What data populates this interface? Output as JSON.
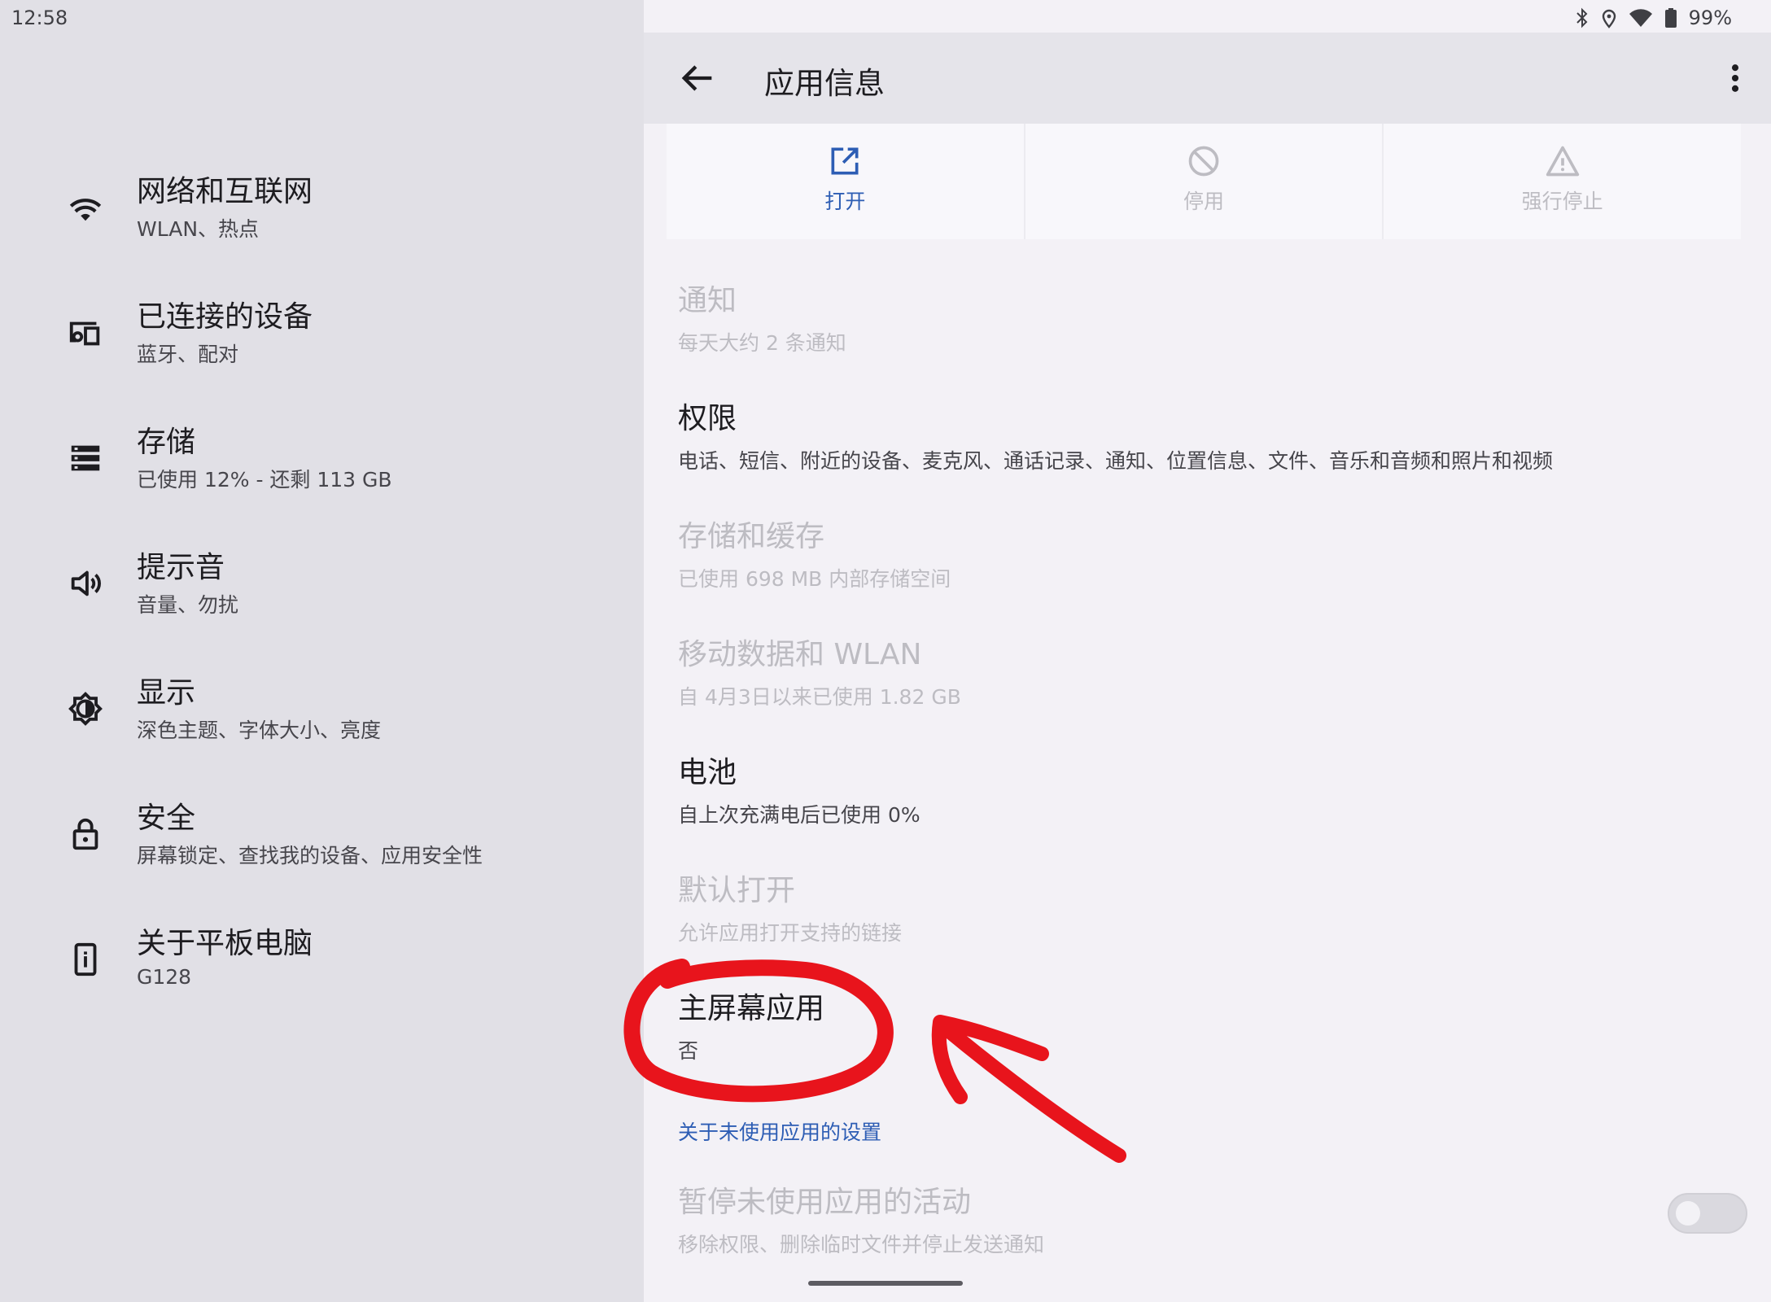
{
  "status_bar": {
    "time": "12:58",
    "battery": "99%",
    "icons": [
      "bluetooth-icon",
      "location-icon",
      "wifi-icon",
      "battery-icon"
    ]
  },
  "sidebar": {
    "items": [
      {
        "title": "网络和互联网",
        "subtitle": "WLAN、热点",
        "icon": "wifi-icon"
      },
      {
        "title": "已连接的设备",
        "subtitle": "蓝牙、配对",
        "icon": "devices-icon"
      },
      {
        "title": "存储",
        "subtitle": "已使用 12% - 还剩 113 GB",
        "icon": "storage-icon"
      },
      {
        "title": "提示音",
        "subtitle": "音量、勿扰",
        "icon": "volume-icon"
      },
      {
        "title": "显示",
        "subtitle": "深色主题、字体大小、亮度",
        "icon": "brightness-icon"
      },
      {
        "title": "安全",
        "subtitle": "屏幕锁定、查找我的设备、应用安全性",
        "icon": "lock-icon"
      },
      {
        "title": "关于平板电脑",
        "subtitle": "G128",
        "icon": "tablet-info-icon"
      }
    ]
  },
  "app_bar": {
    "title": "应用信息"
  },
  "actions": [
    {
      "label": "打开",
      "icon": "open-external-icon",
      "enabled": true
    },
    {
      "label": "停用",
      "icon": "disable-icon",
      "enabled": false
    },
    {
      "label": "强行停止",
      "icon": "warning-icon",
      "enabled": false
    }
  ],
  "rows": [
    {
      "title": "通知",
      "subtitle": "每天大约 2 条通知",
      "enabled": false
    },
    {
      "title": "权限",
      "subtitle": "电话、短信、附近的设备、麦克风、通话记录、通知、位置信息、文件、音乐和音频和照片和视频",
      "enabled": true
    },
    {
      "title": "存储和缓存",
      "subtitle": "已使用 698 MB 内部存储空间",
      "enabled": false
    },
    {
      "title": "移动数据和 WLAN",
      "subtitle": "自 4月3日以来已使用 1.82 GB",
      "enabled": false
    },
    {
      "title": "电池",
      "subtitle": "自上次充满电后已使用 0%",
      "enabled": true
    },
    {
      "title": "默认打开",
      "subtitle": "允许应用打开支持的链接",
      "enabled": false
    },
    {
      "title": "主屏幕应用",
      "subtitle": "否",
      "enabled": true
    }
  ],
  "unused_apps_link": "关于未使用应用的设置",
  "pause_activity": {
    "title": "暂停未使用应用的活动",
    "subtitle": "移除权限、删除临时文件并停止发送通知",
    "toggle_on": false
  },
  "colors": {
    "accent": "#2d5db4",
    "annotation": "#e8141c"
  }
}
